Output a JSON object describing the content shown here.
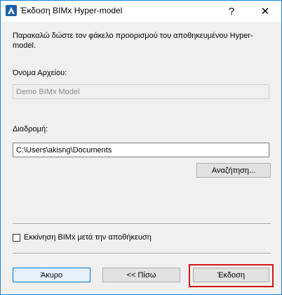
{
  "window": {
    "title": "Έκδοση BIMx Hyper-model",
    "help_glyph": "?",
    "close_glyph": "✕",
    "icon": "archicad-app-icon"
  },
  "dialog": {
    "instructions": "Παρακαλώ δώστε τον φάκελο προορισμού του αποθηκευμένου Hyper-model.",
    "file_name_label": "Όνομα Αρχείου:",
    "file_name_value": "Demo BIMx Model",
    "path_label": "Διαδρομή:",
    "path_value": "C:\\Users\\akisng\\Documents",
    "browse_label": "Αναζήτηση...",
    "launch_checkbox_label": "Εκκίνηση BIMx μετά την αποθήκευση",
    "launch_checked": false
  },
  "footer": {
    "cancel_label": "Άκυρο",
    "back_label": "<< Πίσω",
    "export_label": "Έκδοση"
  },
  "colors": {
    "accent": "#0078d7",
    "highlight_frame": "#d2171b"
  }
}
